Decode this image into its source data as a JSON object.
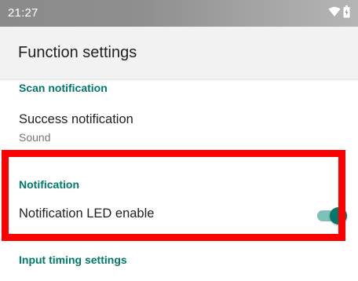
{
  "status_bar": {
    "time": "21:27",
    "icons": [
      "wifi-icon",
      "battery-icon"
    ]
  },
  "app_bar": {
    "title": "Function settings"
  },
  "sections": {
    "scan_notification": {
      "header": "Scan notification",
      "success_notification": {
        "title": "Success notification",
        "summary": "Sound"
      }
    },
    "notification": {
      "header": "Notification",
      "led_enable": {
        "title": "Notification LED enable",
        "checked": true
      }
    },
    "input_timing": {
      "header": "Input timing settings"
    }
  },
  "colors": {
    "accent": "#00796b",
    "switch_track": "#7fc1b8",
    "highlight": "#ff0000",
    "status_bar": "#8f8f8f",
    "app_bar": "#f2f2f2"
  }
}
